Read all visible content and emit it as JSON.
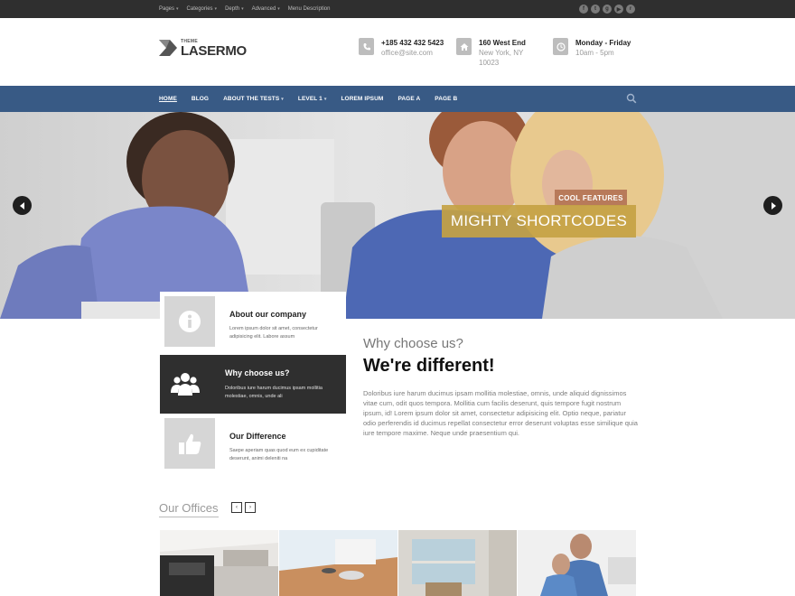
{
  "topbar": {
    "menu": [
      "Pages",
      "Categories",
      "Depth",
      "Advanced",
      "Menu Description"
    ],
    "menu_has_dropdown": [
      true,
      true,
      true,
      true,
      false
    ],
    "social_icons": [
      "facebook-icon",
      "twitter-icon",
      "google-plus-icon",
      "youtube-icon",
      "rss-icon"
    ]
  },
  "header": {
    "logo_small": "THEME",
    "logo_big": "LASERMO",
    "contacts": [
      {
        "icon": "phone-icon",
        "line1": "+185 432 432 5423",
        "line2": "office@site.com",
        "line3": ""
      },
      {
        "icon": "home-icon",
        "line1": "160 West End",
        "line2": "New York, NY",
        "line3": "10023"
      },
      {
        "icon": "clock-icon",
        "line1": "Monday - Friday",
        "line2": "10am - 5pm",
        "line3": ""
      }
    ]
  },
  "nav": {
    "items": [
      "HOME",
      "BLOG",
      "ABOUT THE TESTS",
      "LEVEL 1",
      "LOREM IPSUM",
      "PAGE A",
      "PAGE B"
    ],
    "active_index": 0
  },
  "hero": {
    "tag": "COOL FEATURES",
    "title": "MIGHTY SHORTCODES"
  },
  "features": [
    {
      "title": "About our company",
      "desc": "Lorem ipsum dolor sit amet, consectetur adipisicing elit. Labore assum"
    },
    {
      "title": "Why choose us?",
      "desc": "Doloribus iure harum ducimus ipsam mollitia molestiae, omnis, unde ali"
    },
    {
      "title": "Our Difference",
      "desc": "Saepe aperiam quas quod eum ex cupiditate deserunt, animi deleniti na"
    }
  ],
  "why": {
    "subtitle": "Why choose us?",
    "title": "We're different!",
    "text": "Doloribus iure harum ducimus ipsam mollitia molestiae, omnis, unde aliquid dignissimos vitae cum, odit quos tempora. Mollitia cum facilis deserunt, quis tempore fugit nostrum ipsum, id! Lorem ipsum dolor sit amet, consectetur adipisicing elit. Optio neque, pariatur odio perferendis id ducimus repellat consectetur error deserunt voluptas esse similique quia iure tempore maxime. Neque unde praesentium qui."
  },
  "offices": {
    "title": "Our Offices",
    "prev": "‹",
    "next": "›"
  }
}
